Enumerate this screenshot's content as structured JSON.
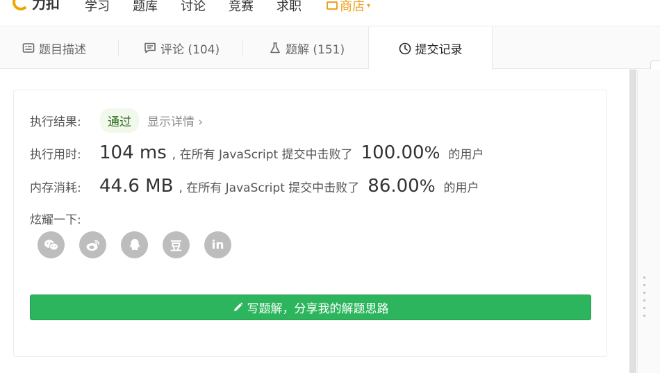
{
  "nav": {
    "brand": "力扣",
    "items": [
      "学习",
      "题库",
      "讨论",
      "竞赛",
      "求职"
    ],
    "store": "商店"
  },
  "tabs": [
    {
      "label": "题目描述",
      "icon": "description-icon"
    },
    {
      "label": "评论 (104)",
      "icon": "comment-icon"
    },
    {
      "label": "题解 (151)",
      "icon": "flask-icon"
    },
    {
      "label": "提交记录",
      "icon": "clock-icon"
    }
  ],
  "result": {
    "status_label": "执行结果:",
    "status_value": "通过",
    "details_label": "显示详情",
    "details_chevron": "›",
    "runtime_label": "执行用时:",
    "runtime_value": "104 ms",
    "runtime_text": ", 在所有 JavaScript 提交中击败了",
    "runtime_pct": "100.00",
    "memory_label": "内存消耗:",
    "memory_value": "44.6 MB",
    "memory_text": ", 在所有 JavaScript 提交中击败了",
    "memory_pct": "86.00",
    "percent_sign": "%",
    "users_suffix": "的用户",
    "share_label": "炫耀一下:"
  },
  "share": [
    "wechat-icon",
    "weibo-icon",
    "qq-icon",
    "douban-icon",
    "linkedin-icon"
  ],
  "share_glyphs": {
    "douban": "豆",
    "linkedin": "in"
  },
  "write_solution": "写题解，分享我的解题思路",
  "colors": {
    "accent_green": "#2db55d",
    "store_orange": "#f0a020",
    "pass_badge_bg": "#f1f8ec"
  }
}
